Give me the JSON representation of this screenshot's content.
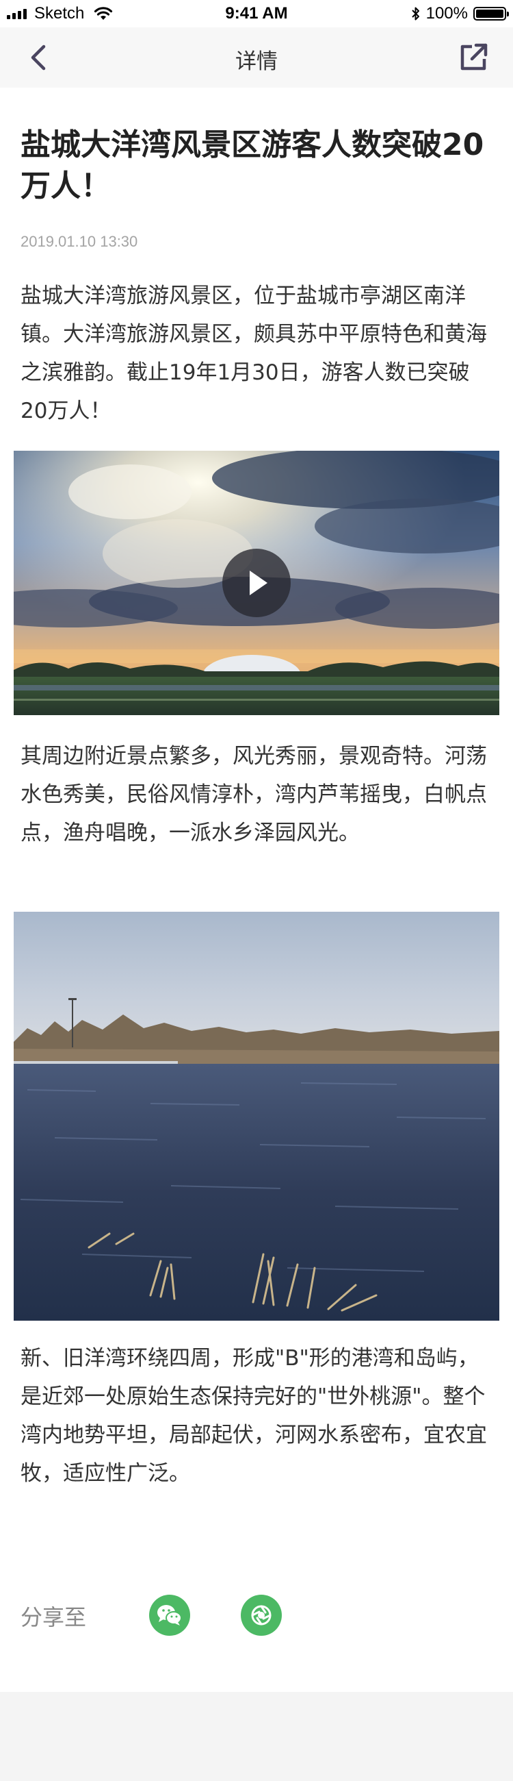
{
  "status_bar": {
    "carrier": "Sketch",
    "time": "9:41 AM",
    "battery": "100%"
  },
  "nav": {
    "title": "详情"
  },
  "article": {
    "title": "盐城大洋湾风景区游客人数突破20万人！",
    "date": "2019.01.10 13:30",
    "paragraphs": [
      "盐城大洋湾旅游风景区，位于盐城市亭湖区南洋镇。大洋湾旅游风景区，颇具苏中平原特色和黄海之滨雅韵。截止19年1月30日，游客人数已突破20万人！",
      "其周边附近景点繁多，风光秀丽，景观奇特。河荡水色秀美，民俗风情淳朴，湾内芦苇摇曳，白帆点点，渔舟唱晚，一派水乡泽园风光。",
      "新、旧洋湾环绕四周，形成\"B\"形的港湾和岛屿，是近郊一处原始生态保持完好的\"世外桃源\"。整个湾内地势平坦，局部起伏，河网水系密布，宜农宜牧，适应性广泛。"
    ]
  },
  "share": {
    "label": "分享至",
    "targets": [
      "wechat-icon",
      "moments-icon"
    ]
  },
  "colors": {
    "accent_green": "#4cb964",
    "date_gray": "#a4a4a4",
    "nav_bg": "#f7f7f7"
  }
}
